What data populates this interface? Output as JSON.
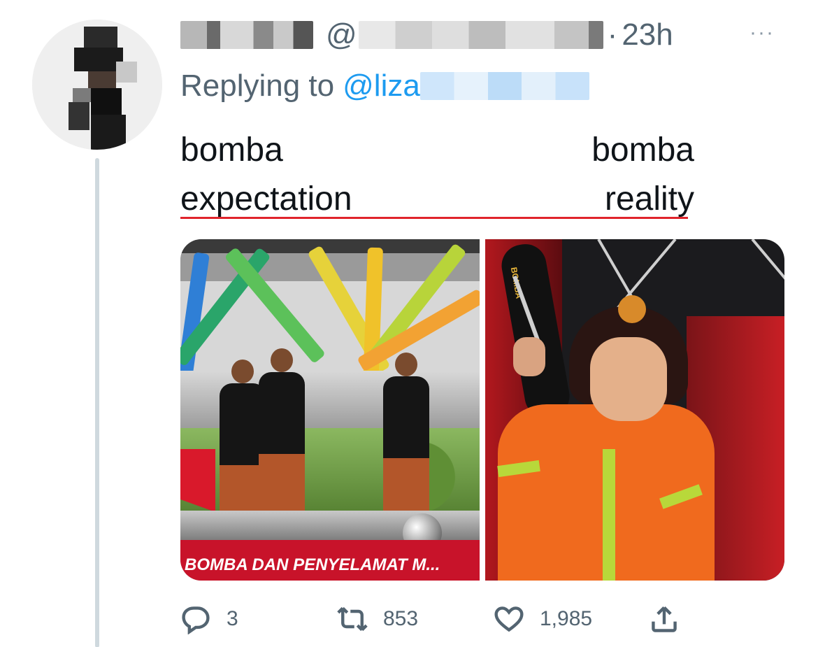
{
  "tweet": {
    "timestamp": "23h",
    "at_symbol": "@",
    "dot": "·",
    "reply_prefix": "Replying to",
    "reply_mention": "@liza",
    "more_menu": "···",
    "text": {
      "left_top": "bomba",
      "left_bottom": "expectation",
      "right_top": "bomba",
      "right_bottom": "reality"
    },
    "media": {
      "left_truck_text": "BOMBA DAN PENYELAMAT M...",
      "right_tube_text": "BOMBA"
    },
    "actions": {
      "replies": "3",
      "retweets": "853",
      "likes": "1,985"
    }
  },
  "colors": {
    "link_blue": "#1d9bf0",
    "secondary_text": "#536471",
    "underline_red": "#e0242b"
  },
  "icons": [
    "more-icon",
    "reply-icon",
    "retweet-icon",
    "like-icon",
    "share-icon"
  ]
}
